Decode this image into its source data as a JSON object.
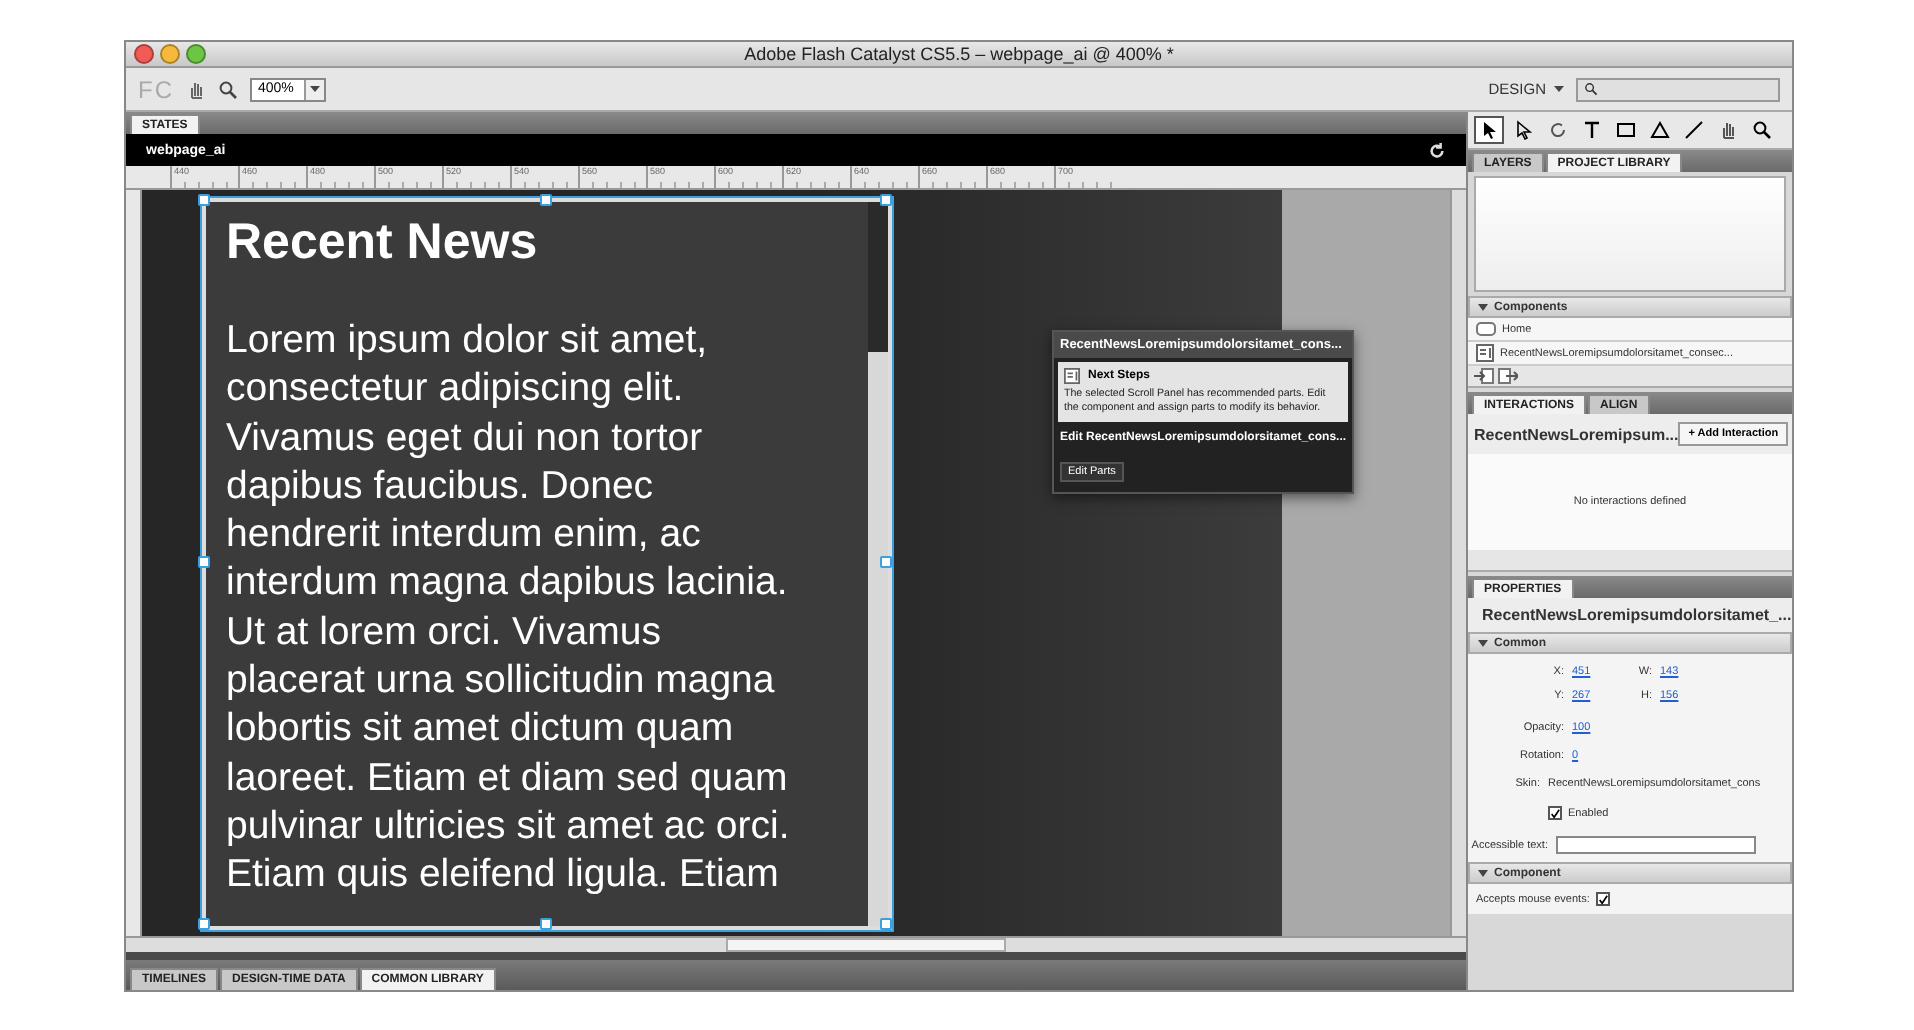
{
  "window": {
    "title": "Adobe Flash Catalyst CS5.5 – webpage_ai @ 400% *"
  },
  "toolbar": {
    "logo": "FC",
    "zoom": "400%",
    "workspace": "DESIGN"
  },
  "states_panel": {
    "tab": "STATES",
    "page": "webpage_ai"
  },
  "ruler": {
    "ticks": [
      "440",
      "460",
      "480",
      "500",
      "520",
      "540",
      "560",
      "580",
      "600",
      "620",
      "640",
      "660",
      "680",
      "700"
    ]
  },
  "artboard": {
    "heading": "Recent News",
    "body": "Lorem ipsum dolor sit amet, consectetur adipiscing elit. Vivamus eget dui non tortor dapibus faucibus. Donec hendrerit interdum enim, ac interdum magna dapibus lacinia. Ut at lorem orci. Vivamus placerat urna sollicitudin magna lobortis sit amet dictum quam laoreet. Etiam et diam sed quam pulvinar ultricies sit amet ac orci. Etiam quis eleifend ligula. Etiam"
  },
  "hud": {
    "title": "RecentNewsLoremipsumdolorsitamet_cons...",
    "heading": "Next Steps",
    "message": "The selected Scroll Panel has recommended parts. Edit the component and assign parts to modify its behavior.",
    "edit_label": "Edit RecentNewsLoremipsumdolorsitamet_cons...",
    "button": "Edit Parts"
  },
  "tools": [
    {
      "kind": "select",
      "selected": true
    },
    {
      "kind": "direct",
      "selected": false
    },
    {
      "kind": "rotate",
      "selected": false
    },
    {
      "kind": "text",
      "selected": false
    },
    {
      "kind": "rect",
      "selected": false
    },
    {
      "kind": "triangle",
      "selected": false
    },
    {
      "kind": "line",
      "selected": false
    },
    {
      "kind": "hand",
      "selected": false
    },
    {
      "kind": "zoom",
      "selected": false
    }
  ],
  "library_tabs": [
    {
      "label": "LAYERS",
      "selected": false
    },
    {
      "label": "PROJECT LIBRARY",
      "selected": true
    }
  ],
  "components": {
    "title": "Components",
    "expanded": true,
    "items": [
      {
        "kind": "button",
        "label": "Home"
      },
      {
        "kind": "panel",
        "label": "RecentNewsLoremipsumdolorsitamet_consec..."
      }
    ]
  },
  "interaction_tabs": [
    {
      "label": "INTERACTIONS",
      "selected": true
    },
    {
      "label": "ALIGN",
      "selected": false
    }
  ],
  "interactions": {
    "target": "RecentNewsLoremipsum...",
    "add_button": "+ Add Interaction",
    "empty": "No interactions defined"
  },
  "properties": {
    "tab": "PROPERTIES",
    "target": "RecentNewsLoremipsumdolorsitamet_...",
    "common": {
      "title": "Common",
      "expanded": true
    },
    "geometry": [
      {
        "label": "X:",
        "value": "451"
      },
      {
        "label": "W:",
        "value": "143"
      },
      {
        "label": "Y:",
        "value": "267"
      },
      {
        "label": "H:",
        "value": "156"
      }
    ],
    "opacity": {
      "label": "Opacity:",
      "value": "100"
    },
    "rotation": {
      "label": "Rotation:",
      "value": "0"
    },
    "skin": {
      "label": "Skin:",
      "value": "RecentNewsLoremipsumdolorsitamet_cons"
    },
    "enabled": {
      "label": "Enabled",
      "checked": true
    },
    "accessible_text": {
      "label": "Accessible text:"
    },
    "component": {
      "title": "Component",
      "expanded": true
    },
    "accepts_mouse": {
      "label": "Accepts mouse events:",
      "checked": true
    }
  },
  "bottom_tabs": [
    {
      "label": "TIMELINES",
      "selected": false
    },
    {
      "label": "DESIGN-TIME DATA",
      "selected": false
    },
    {
      "label": "COMMON LIBRARY",
      "selected": true
    }
  ]
}
